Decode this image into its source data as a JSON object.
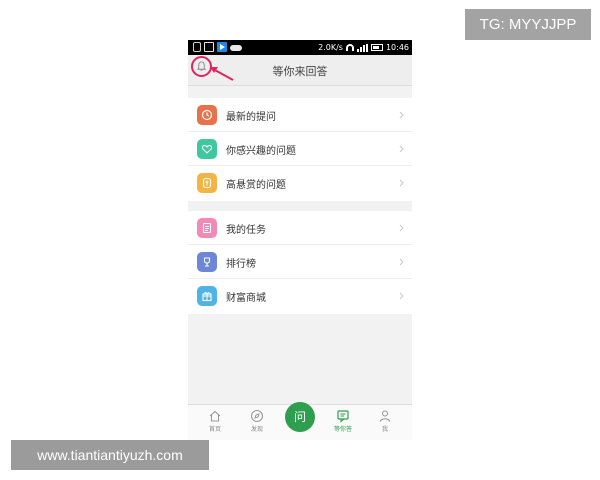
{
  "status_bar": {
    "speed": "2.0K/s",
    "time": "10:46"
  },
  "header": {
    "title": "等你来回答",
    "left_icon": "bell-icon"
  },
  "menu_groups": [
    {
      "items": [
        {
          "label": "最新的提问",
          "icon": "clock-icon",
          "color": "#e8704b"
        },
        {
          "label": "你感兴趣的问题",
          "icon": "heart-icon",
          "color": "#3fc8a0"
        },
        {
          "label": "高悬赏的问题",
          "icon": "coin-icon",
          "color": "#f2b544"
        }
      ]
    },
    {
      "items": [
        {
          "label": "我的任务",
          "icon": "task-icon",
          "color": "#f08ab7"
        },
        {
          "label": "排行榜",
          "icon": "trophy-icon",
          "color": "#6e86d6"
        },
        {
          "label": "财富商城",
          "icon": "gift-icon",
          "color": "#4fb3e8"
        }
      ]
    }
  ],
  "tab_bar": {
    "tabs": [
      {
        "label": "首页",
        "icon": "home-icon"
      },
      {
        "label": "发现",
        "icon": "compass-icon"
      },
      {
        "label": "等你答",
        "icon": "answer-icon",
        "active": true
      },
      {
        "label": "我",
        "icon": "user-icon"
      }
    ],
    "center_button": "问"
  },
  "watermarks": {
    "top_right": "TG: MYYJJPP",
    "bottom_left": "www.tiantiantiyuzh.com"
  },
  "colors": {
    "accent": "#2e9e4f",
    "annotation": "#e0245e"
  }
}
